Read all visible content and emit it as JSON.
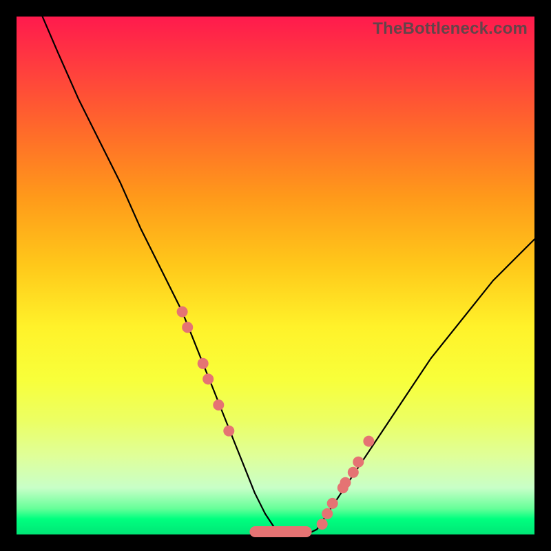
{
  "watermark": "TheBottleneck.com",
  "colors": {
    "curve": "#000000",
    "marker": "#e57373",
    "gradient_top": "#ff1a4d",
    "gradient_bottom": "#00e676",
    "frame": "#000000"
  },
  "chart_data": {
    "type": "line",
    "title": "",
    "xlabel": "",
    "ylabel": "",
    "xlim": [
      0,
      100
    ],
    "ylim": [
      0,
      100
    ],
    "grid": false,
    "series": [
      {
        "name": "bottleneck-curve",
        "x": [
          5,
          8,
          12,
          16,
          20,
          24,
          28,
          32,
          34,
          36,
          38,
          40,
          42,
          44,
          46,
          48,
          50,
          52,
          54,
          56,
          58,
          60,
          64,
          68,
          72,
          76,
          80,
          84,
          88,
          92,
          96,
          100
        ],
        "y": [
          100,
          93,
          84,
          76,
          68,
          59,
          51,
          43,
          38,
          33,
          28,
          23,
          18,
          13,
          8,
          4,
          1,
          0,
          0,
          0,
          1,
          4,
          10,
          16,
          22,
          28,
          34,
          39,
          44,
          49,
          53,
          57
        ]
      }
    ],
    "markers": [
      {
        "x": 32,
        "y": 43
      },
      {
        "x": 33,
        "y": 40
      },
      {
        "x": 36,
        "y": 33
      },
      {
        "x": 37,
        "y": 30
      },
      {
        "x": 39,
        "y": 25
      },
      {
        "x": 41,
        "y": 20
      },
      {
        "x": 59,
        "y": 2
      },
      {
        "x": 60,
        "y": 4
      },
      {
        "x": 61,
        "y": 6
      },
      {
        "x": 63,
        "y": 9
      },
      {
        "x": 63.5,
        "y": 10
      },
      {
        "x": 65,
        "y": 12
      },
      {
        "x": 66,
        "y": 14
      },
      {
        "x": 68,
        "y": 18
      }
    ],
    "bottom_blob": {
      "x_start": 45,
      "x_end": 57,
      "height": 2
    }
  }
}
